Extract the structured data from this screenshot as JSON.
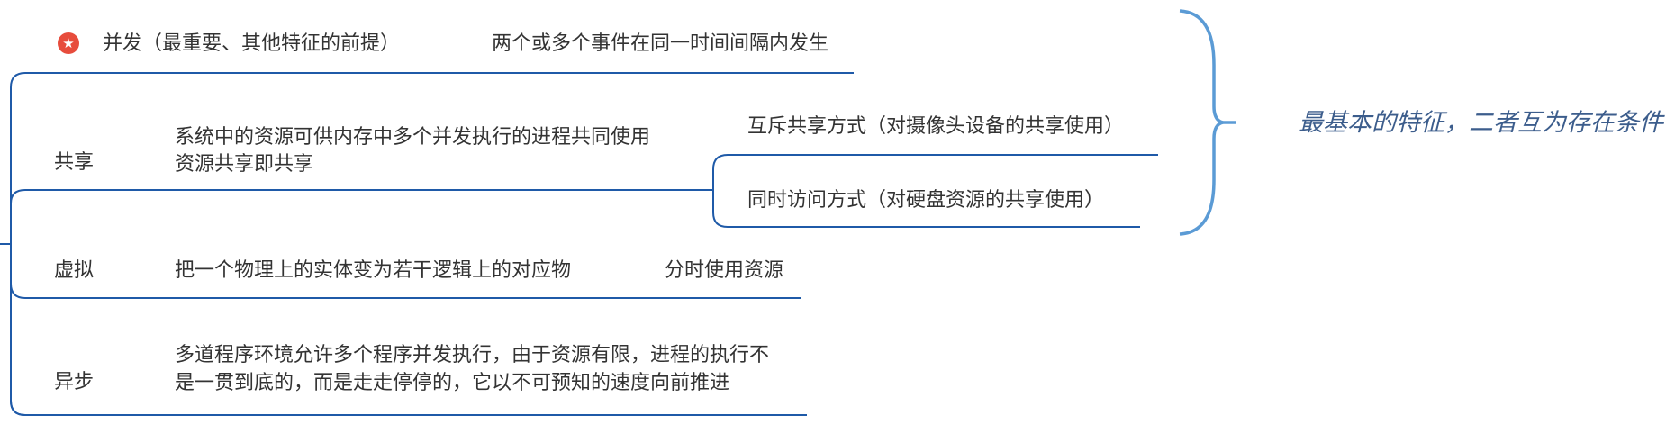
{
  "colors": {
    "branch_line": "#1f5aa8",
    "summary_brace": "#5b9bd5",
    "summary_text": "#3c5d8c",
    "text": "#333333",
    "priority_badge": "#e74c3c"
  },
  "branches": [
    {
      "title": "并发（最重要、其他特征的前提）",
      "priority_icon": "star-icon",
      "description": "两个或多个事件在同一时间间隔内发生"
    },
    {
      "title": "共享",
      "description_lines": [
        "系统中的资源可供内存中多个并发执行的进程共同使用",
        "资源共享即共享"
      ],
      "children": [
        "互斥共享方式（对摄像头设备的共享使用）",
        "同时访问方式（对硬盘资源的共享使用）"
      ]
    },
    {
      "title": "虚拟",
      "description": "把一个物理上的实体变为若干逻辑上的对应物",
      "child": "分时使用资源"
    },
    {
      "title": "异步",
      "description_lines": [
        "多道程序环境允许多个程序并发执行，由于资源有限，进程的执行不",
        "是一贯到底的，而是走走停停的，它以不可预知的速度向前推进"
      ]
    }
  ],
  "summary": {
    "text": "最基本的特征，二者互为存在条件"
  }
}
